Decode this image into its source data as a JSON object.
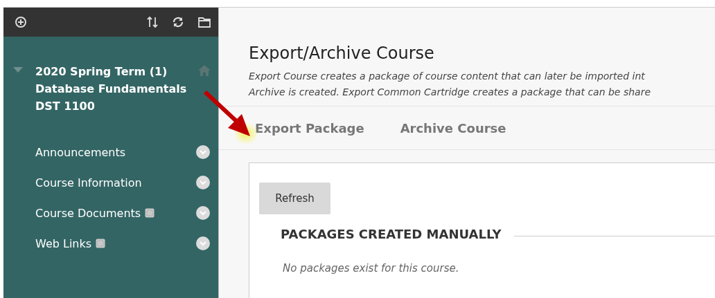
{
  "sidebar": {
    "course_title_lines": [
      "2020 Spring Term (1)",
      "Database Fundamentals",
      "DST 1100"
    ],
    "expanded": true,
    "items": [
      {
        "label": "Announcements",
        "badge": false
      },
      {
        "label": "Course Information",
        "badge": false
      },
      {
        "label": "Course Documents",
        "badge": true
      },
      {
        "label": "Web Links",
        "badge": true
      }
    ]
  },
  "page": {
    "title": "Export/Archive Course",
    "description_lines": [
      "Export Course creates a package of course content that can later be imported int",
      "Archive is created. Export Common Cartridge creates a package that can be share"
    ]
  },
  "tabs": [
    {
      "label": "Export Package"
    },
    {
      "label": "Archive Course"
    }
  ],
  "panel": {
    "button": "Refresh",
    "section_title": "PACKAGES CREATED MANUALLY",
    "empty_message": "No packages exist for this course."
  }
}
